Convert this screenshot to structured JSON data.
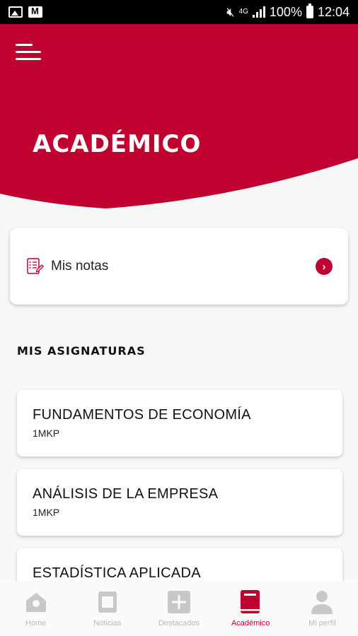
{
  "status_bar": {
    "battery_text": "100%",
    "time": "12:04",
    "network": "4G"
  },
  "header": {
    "title": "ACADÉMICO",
    "brand_color": "#c0002f"
  },
  "notas": {
    "label": "Mis notas"
  },
  "subjects_section": {
    "title": "MIS ASIGNATURAS",
    "items": [
      {
        "name": "FUNDAMENTOS DE ECONOMÍA",
        "code": "1MKP"
      },
      {
        "name": "ANÁLISIS DE LA EMPRESA",
        "code": "1MKP"
      },
      {
        "name": "ESTADÍSTICA APLICADA",
        "code": ""
      }
    ]
  },
  "bottom_nav": {
    "items": [
      {
        "label": "Home",
        "icon": "home-icon",
        "active": false
      },
      {
        "label": "Noticias",
        "icon": "news-icon",
        "active": false
      },
      {
        "label": "Destacados",
        "icon": "plus-icon",
        "active": false
      },
      {
        "label": "Académico",
        "icon": "book-icon",
        "active": true
      },
      {
        "label": "Mi perfil",
        "icon": "user-icon",
        "active": false
      }
    ],
    "active_color": "#c0002f",
    "inactive_color": "#c8c8c8"
  }
}
